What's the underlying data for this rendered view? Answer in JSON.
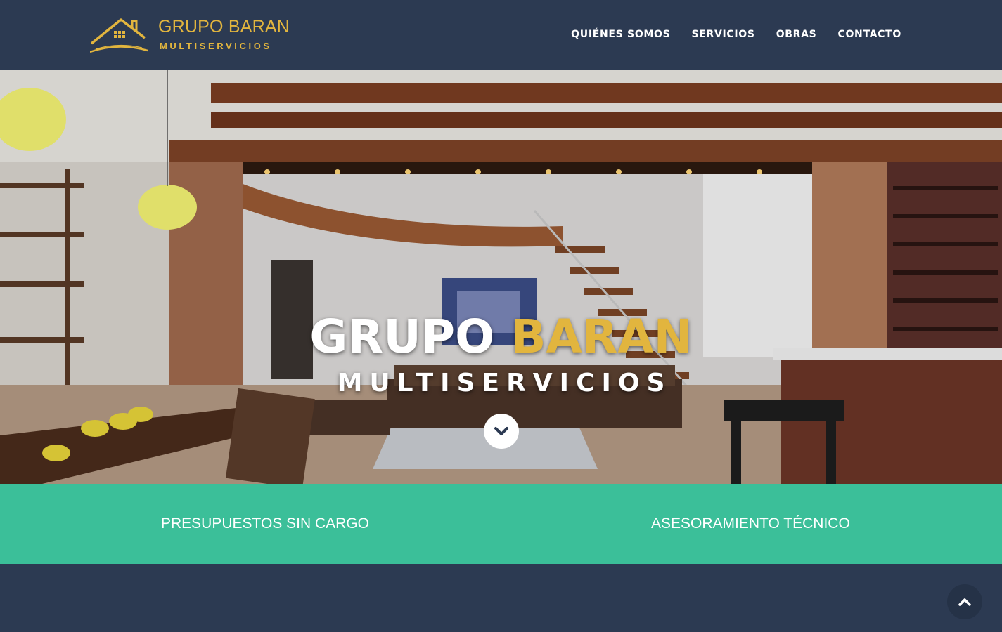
{
  "brand": {
    "title": "GRUPO BARAN",
    "subtitle": "MULTISERVICIOS",
    "gold": "#e2b53e"
  },
  "nav": {
    "items": [
      {
        "label": "QUIÉNES SOMOS"
      },
      {
        "label": "SERVICIOS"
      },
      {
        "label": "OBRAS"
      },
      {
        "label": "CONTACTO"
      }
    ]
  },
  "hero": {
    "title_white": "GRUPO",
    "title_gold": "BARAN",
    "subtitle": "MULTISERVICIOS",
    "scroll_icon": "chevron-down-icon"
  },
  "band": {
    "left": "PRESUPUESTOS SIN CARGO",
    "right": "ASESORAMIENTO TÉCNICO",
    "color": "#3bbf99"
  },
  "back_to_top": {
    "icon": "chevron-up-icon"
  },
  "colors": {
    "navy": "#2c3a52",
    "accent_gold": "#e2b53e",
    "teal": "#3bbf99"
  }
}
